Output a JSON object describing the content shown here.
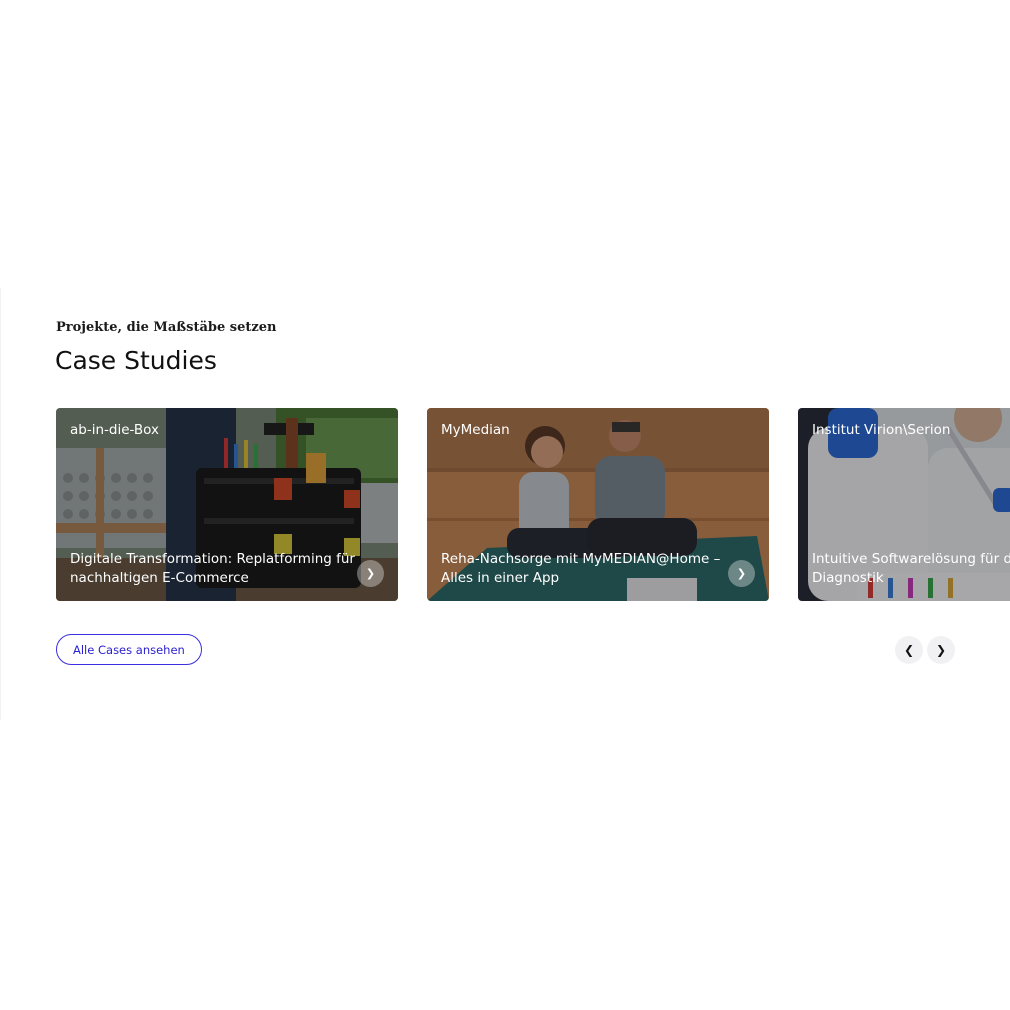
{
  "section": {
    "eyebrow": "Projekte, die Maßstäbe setzen",
    "title": "Case Studies"
  },
  "cards": [
    {
      "client": "ab-in-die-Box",
      "description": "Digitale Transformation: Replatforming für nachhaltigen E-Commerce",
      "image_desc": "person carrying black tool cases with tools",
      "arrow_icon": "chevron-right-icon"
    },
    {
      "client": "MyMedian",
      "description": "Reha-Nachsorge mit MyMEDIAN@Home – Alles in einer App",
      "image_desc": "couple laughing on yoga mat with laptop",
      "arrow_icon": "chevron-right-icon"
    },
    {
      "client": "Institut Virion\\Serion",
      "description": "Intuitive Softwarelösung für die sche Diagnostik",
      "image_desc": "lab scientist with pipette and test tubes"
    }
  ],
  "actions": {
    "all_cases_label": "Alle Cases ansehen",
    "prev_icon": "chevron-left-icon",
    "next_icon": "chevron-right-icon"
  },
  "colors": {
    "accent": "#2a1fd0",
    "nav_bg": "#f1f1f4"
  }
}
